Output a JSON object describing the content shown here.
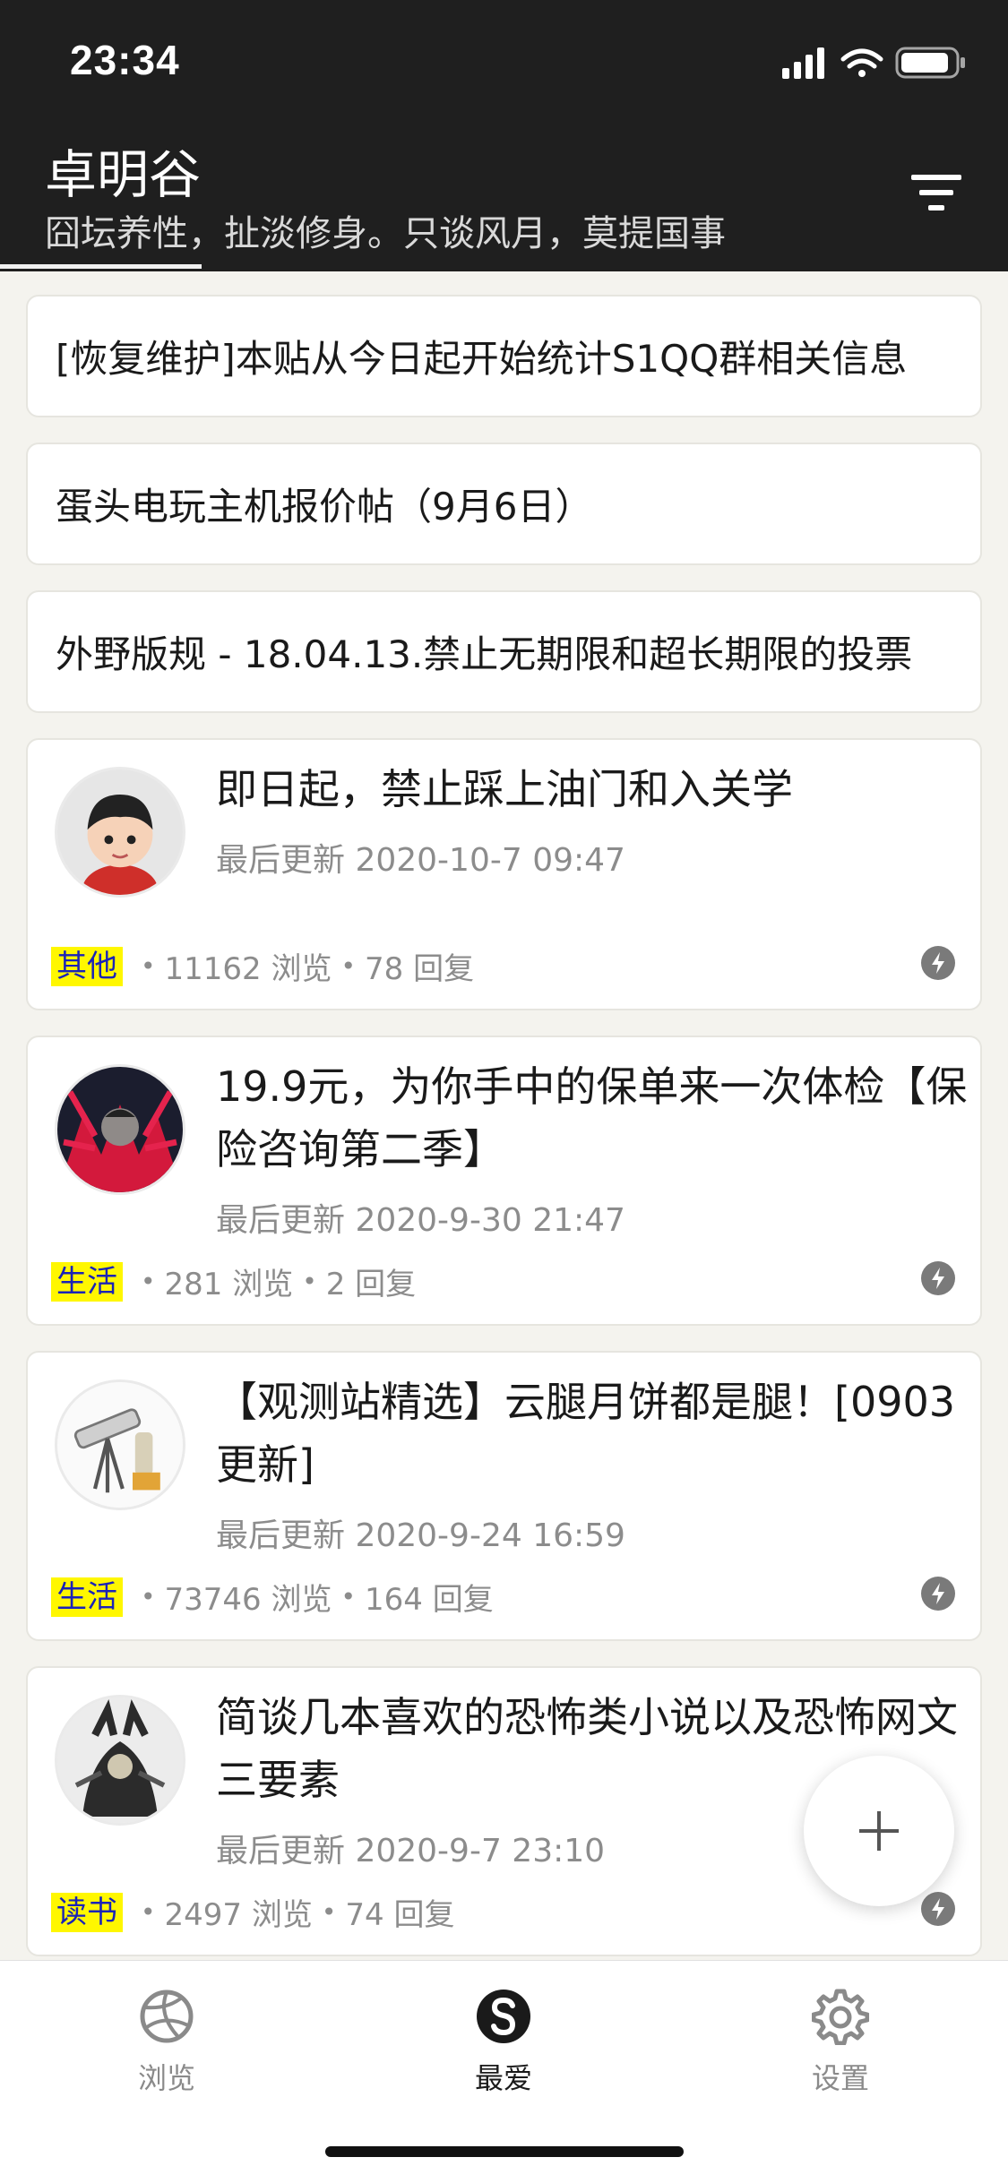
{
  "status_bar": {
    "time": "23:34"
  },
  "header": {
    "title": "卓明谷",
    "subtitle": "囧坛养性，扯淡修身。只谈风月，莫提国事",
    "filter_icon": "filter-lines-icon"
  },
  "notices": [
    {
      "text": "[恢复维护]本贴从今日起开始统计S1QQ群相关信息"
    },
    {
      "text": "蛋头电玩主机报价帖（9月6日）"
    },
    {
      "text": "外野版规 - 18.04.13.禁止无期限和超长期限的投票"
    }
  ],
  "posts": [
    {
      "title": "即日起，禁止踩上油门和入关学",
      "date": "最后更新 2020-10-7 09:47",
      "tag": "其他",
      "views": "11162 浏览",
      "replies": "78 回复"
    },
    {
      "title": "19.9元，为你手中的保单来一次体检【保险咨询第二季】",
      "date": "最后更新 2020-9-30 21:47",
      "tag": "生活",
      "views": "281 浏览",
      "replies": "2 回复"
    },
    {
      "title": "【观测站精选】云腿月饼都是腿！[0903更新]",
      "date": "最后更新 2020-9-24 16:59",
      "tag": "生活",
      "views": "73746 浏览",
      "replies": "164 回复"
    },
    {
      "title": "简谈几本喜欢的恐怖类小说以及恐怖网文三要素",
      "date": "最后更新 2020-9-7 23:10",
      "tag": "读书",
      "views": "2497 浏览",
      "replies": "74 回复"
    }
  ],
  "fab": {
    "icon": "plus-icon"
  },
  "tabbar": {
    "items": [
      {
        "label": "浏览",
        "icon": "volleyball-icon"
      },
      {
        "label": "最爱",
        "icon": "s-logo-icon"
      },
      {
        "label": "设置",
        "icon": "gear-icon"
      }
    ]
  },
  "colors": {
    "header_bg": "#1f1f1f",
    "tag_bg": "#fff700",
    "tag_text": "#1a23b8",
    "page_bg": "#f4f3ee"
  }
}
